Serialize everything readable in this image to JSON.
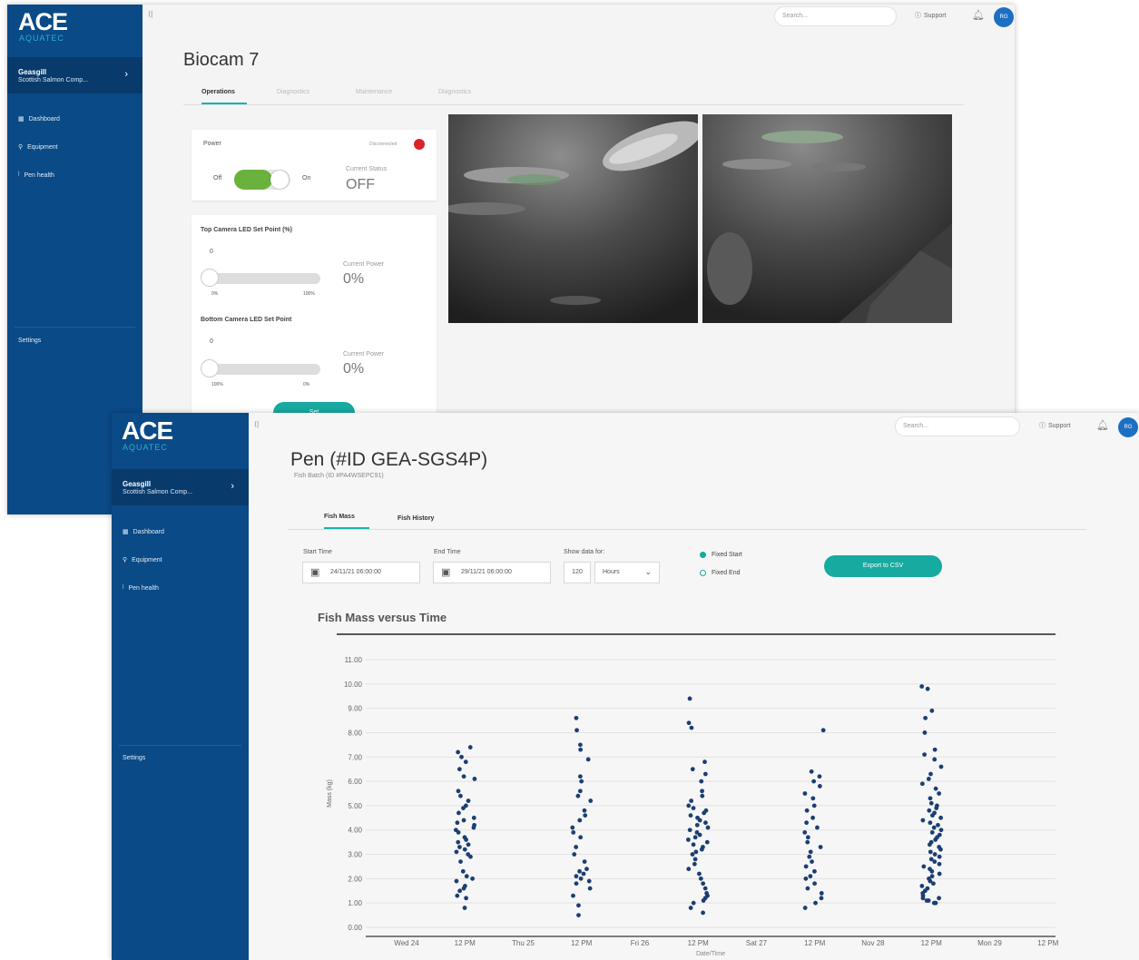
{
  "window1": {
    "logo": "ACE",
    "logo_sub": "AQUATEC",
    "org_name": "Geasgill",
    "org_company": "Scottish Salmon Comp...",
    "nav": [
      {
        "icon": "dashboard-icon",
        "label": "Dashboard"
      },
      {
        "icon": "wrench-icon",
        "label": "Equipment"
      },
      {
        "icon": "heart-icon",
        "label": "Pen health"
      }
    ],
    "settings": "Settings",
    "search_placeholder": "Search...",
    "support": "Support",
    "avatar": "RG",
    "page_title": "Biocam 7",
    "tabs": [
      "Operations",
      "Diagnostics",
      "Maintenance",
      "Diagnostics"
    ],
    "power": {
      "label": "Power",
      "status_badge": "Disconnected",
      "off": "Off",
      "on": "On",
      "current_status_label": "Current Status",
      "current_status": "OFF"
    },
    "top_led": {
      "label": "Top Camera LED Set Point (%)",
      "value": "0",
      "min": "0%",
      "max": "100%",
      "current_power_label": "Current Power",
      "current_power": "0%"
    },
    "bottom_led": {
      "label": "Bottom Camera LED Set Point",
      "value": "0",
      "min": "100%",
      "max": "0%",
      "current_power_label": "Current Power",
      "current_power": "0%"
    },
    "set_button": "Set"
  },
  "window2": {
    "logo": "ACE",
    "logo_sub": "AQUATEC",
    "org_name": "Geasgill",
    "org_company": "Scottish Salmon Comp...",
    "nav": [
      {
        "icon": "dashboard-icon",
        "label": "Dashboard"
      },
      {
        "icon": "wrench-icon",
        "label": "Equipment"
      },
      {
        "icon": "heart-icon",
        "label": "Pen health"
      }
    ],
    "settings": "Settings",
    "search_placeholder": "Search...",
    "support": "Support",
    "avatar": "RG",
    "page_title": "Pen (#ID GEA-SGS4P)",
    "page_subtitle": "Fish Batch (ID #PA4WSEPC91)",
    "tabs": [
      "Fish Mass",
      "Fish History"
    ],
    "start_time_label": "Start Time",
    "start_time": "24/11/21 06:00:00",
    "end_time_label": "End Time",
    "end_time": "29/11/21 06:00:00",
    "show_data_label": "Show data for:",
    "show_data_value": "120",
    "show_data_unit": "Hours",
    "fixed_start": "Fixed Start",
    "fixed_end": "Fixed End",
    "export_button": "Export to CSV"
  },
  "chart_data": {
    "type": "scatter",
    "title": "Fish Mass versus Time",
    "ylabel": "Mass (kg)",
    "xlabel": "Date/Time",
    "ylim": [
      0,
      11
    ],
    "y_ticks": [
      "0.00",
      "1.00",
      "2.00",
      "3.00",
      "4.00",
      "5.00",
      "6.00",
      "7.00",
      "8.00",
      "9.00",
      "10.00",
      "11.00"
    ],
    "x_ticks": [
      "Wed 24",
      "12 PM",
      "Thu 25",
      "12 PM",
      "Fri 26",
      "12 PM",
      "Sat 27",
      "12 PM",
      "Nov 28",
      "12 PM",
      "Mon 29",
      "12 PM"
    ],
    "grid": true,
    "clusters": [
      {
        "x_tick": "12 PM",
        "day": 1,
        "points": [
          0.8,
          1.2,
          1.3,
          1.5,
          1.6,
          1.7,
          1.9,
          2.0,
          2.1,
          2.3,
          2.7,
          2.9,
          3.0,
          3.1,
          3.2,
          3.3,
          3.4,
          3.5,
          3.6,
          3.7,
          3.9,
          4.0,
          4.1,
          4.2,
          4.3,
          4.4,
          4.5,
          4.7,
          4.9,
          5.0,
          5.2,
          5.4,
          5.6,
          6.1,
          6.2,
          6.5,
          6.8,
          7.0,
          7.2,
          7.4
        ]
      },
      {
        "x_tick": "12 PM",
        "day": 2,
        "points": [
          0.5,
          0.9,
          1.3,
          1.6,
          1.8,
          1.9,
          2.0,
          2.1,
          2.2,
          2.3,
          2.4,
          2.7,
          3.0,
          3.3,
          3.7,
          3.9,
          4.1,
          4.4,
          4.6,
          4.8,
          5.2,
          5.4,
          5.6,
          6.0,
          6.2,
          6.9,
          7.3,
          7.5,
          8.1,
          8.6
        ]
      },
      {
        "x_tick": "12 PM",
        "day": 3,
        "points": [
          0.6,
          0.8,
          1.0,
          1.1,
          1.2,
          1.3,
          1.4,
          1.6,
          1.8,
          2.0,
          2.2,
          2.4,
          2.6,
          2.8,
          3.0,
          3.1,
          3.2,
          3.3,
          3.4,
          3.5,
          3.6,
          3.7,
          3.8,
          3.9,
          4.0,
          4.1,
          4.2,
          4.3,
          4.4,
          4.5,
          4.6,
          4.7,
          4.8,
          4.9,
          5.0,
          5.2,
          5.4,
          5.6,
          6.0,
          6.3,
          6.5,
          6.8,
          8.2,
          8.4,
          9.4
        ]
      },
      {
        "x_tick": "12 PM",
        "day": 4,
        "points": [
          0.8,
          1.0,
          1.2,
          1.4,
          1.6,
          1.8,
          2.0,
          2.1,
          2.3,
          2.5,
          2.7,
          2.9,
          3.1,
          3.3,
          3.5,
          3.7,
          3.9,
          4.1,
          4.3,
          4.5,
          4.8,
          5.0,
          5.3,
          5.5,
          5.8,
          6.0,
          6.2,
          6.4,
          8.1
        ]
      },
      {
        "x_tick": "12 PM",
        "day": 5,
        "points": [
          1.0,
          1.0,
          1.1,
          1.1,
          1.2,
          1.2,
          1.3,
          1.4,
          1.5,
          1.6,
          1.7,
          1.8,
          1.9,
          2.0,
          2.1,
          2.2,
          2.3,
          2.4,
          2.5,
          2.6,
          2.7,
          2.8,
          2.9,
          3.0,
          3.1,
          3.2,
          3.3,
          3.4,
          3.5,
          3.6,
          3.7,
          3.8,
          3.9,
          4.0,
          4.1,
          4.2,
          4.3,
          4.4,
          4.5,
          4.6,
          4.7,
          4.8,
          4.9,
          5.0,
          5.1,
          5.3,
          5.5,
          5.7,
          5.9,
          6.1,
          6.3,
          6.6,
          6.9,
          7.1,
          7.3,
          8.0,
          8.6,
          8.9,
          9.8,
          9.9
        ]
      }
    ],
    "color": "#1b3f73"
  }
}
